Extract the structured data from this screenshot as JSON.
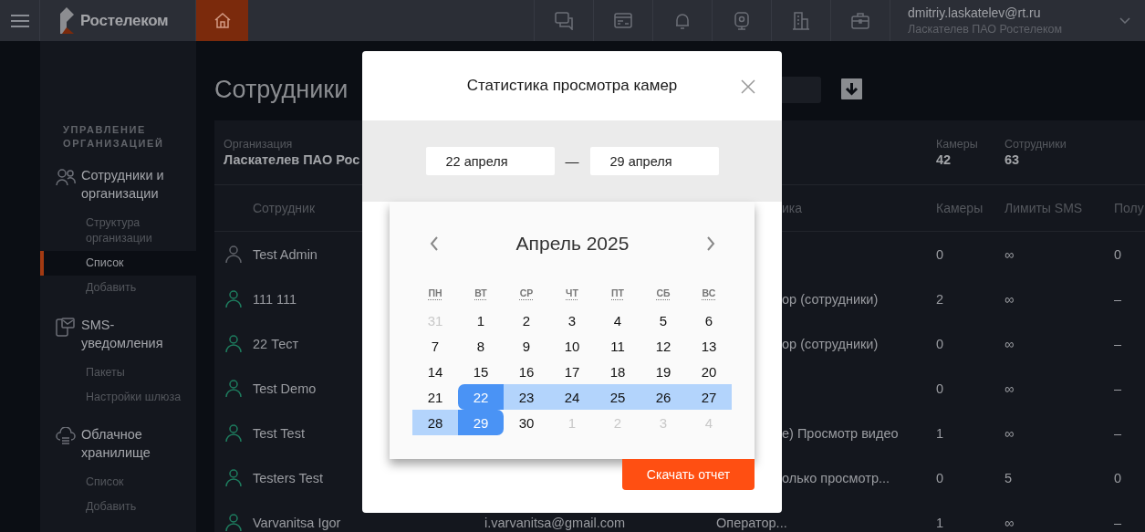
{
  "topbar": {
    "logo": "Ростелеком",
    "user_email": "dmitriy.laskatelev@rt.ru",
    "user_org": "Ласкателев ПАО Ростелеком"
  },
  "sidebar": {
    "heading": "УПРАВЛЕНИЕ ОРГАНИЗАЦИЕЙ",
    "groups": [
      {
        "label": "Сотрудники и организации",
        "kind": "people",
        "items": [
          {
            "label": "Структура организации",
            "selected": false
          },
          {
            "label": "Список",
            "selected": true
          },
          {
            "label": "Добавить",
            "selected": false
          }
        ]
      },
      {
        "label": "SMS-уведомления",
        "kind": "sms",
        "items": [
          {
            "label": "Пакеты",
            "selected": false
          },
          {
            "label": "Настройки шлюза",
            "selected": false
          }
        ]
      },
      {
        "label": "Облачное хранилище",
        "kind": "cloud",
        "items": [
          {
            "label": "Список",
            "selected": false
          },
          {
            "label": "Добавить",
            "selected": false
          }
        ]
      }
    ]
  },
  "page": {
    "title": "Сотрудники",
    "organization": {
      "label": "Организация",
      "value": "Ласкателев ПАО Рос"
    },
    "stats": [
      {
        "label": "Камеры",
        "value": "42"
      },
      {
        "label": "Сотрудники",
        "value": "63"
      }
    ]
  },
  "table": {
    "columns": [
      "Сотрудник",
      "ика",
      "Камеры",
      "Лимиты SMS",
      "Полу"
    ],
    "rows": [
      {
        "name": "Test Admin",
        "color": "#5f6269",
        "kind": "covered",
        "cameras": "0",
        "sms_limit": "∞",
        "column_8": "0"
      },
      {
        "name": "111 111",
        "color": "#1e7d5f",
        "kind": "covered",
        "role": "ор (сотрудники)",
        "cameras": "2",
        "sms_limit": "∞",
        "column_8": "–"
      },
      {
        "name": "22 Тест",
        "color": "#1e7d5f",
        "kind": "covered",
        "role": "ор (сотрудники)",
        "cameras": "0",
        "sms_limit": "∞",
        "column_8": "–"
      },
      {
        "name": "Test Demo",
        "color": "#1e7d5f",
        "kind": "covered",
        "cameras": "0",
        "sms_limit": "∞",
        "column_8": "–"
      },
      {
        "name": "Test Test",
        "color": "#1e7d5f",
        "kind": "covered",
        "role": "е) Просмотр видео",
        "cameras": "1",
        "sms_limit": "∞",
        "column_8": "–"
      },
      {
        "name": "Testers Test",
        "color": "#1e7d5f",
        "kind": "covered",
        "role": "олько просмотр...",
        "cameras": "0",
        "sms_limit": "5",
        "column_8": "0"
      },
      {
        "name": "Varvanitsa Igor",
        "color": "#1e7d5f",
        "kind": "full",
        "email": "i.varvanitsa@gmail.com",
        "role": "Оператор...",
        "cameras": "1",
        "sms_limit": "∞",
        "column_8": "–"
      }
    ]
  },
  "modal": {
    "title": "Статистика просмотра камер",
    "date_from": "22 апреля",
    "separator": "—",
    "date_to": "29 апреля",
    "calendar": {
      "month": "Апрель 2025",
      "weekdays": [
        "ПН",
        "ВТ",
        "СР",
        "ЧТ",
        "ПТ",
        "СБ",
        "ВС"
      ],
      "days": [
        {
          "label": "31",
          "outside": true,
          "selected": false,
          "in_range": false
        },
        {
          "label": "1",
          "outside": false,
          "selected": false,
          "in_range": false
        },
        {
          "label": "2",
          "outside": false,
          "selected": false,
          "in_range": false
        },
        {
          "label": "3",
          "outside": false,
          "selected": false,
          "in_range": false
        },
        {
          "label": "4",
          "outside": false,
          "selected": false,
          "in_range": false
        },
        {
          "label": "5",
          "outside": false,
          "selected": false,
          "in_range": false
        },
        {
          "label": "6",
          "outside": false,
          "selected": false,
          "in_range": false
        },
        {
          "label": "7",
          "outside": false,
          "selected": false,
          "in_range": false
        },
        {
          "label": "8",
          "outside": false,
          "selected": false,
          "in_range": false
        },
        {
          "label": "9",
          "outside": false,
          "selected": false,
          "in_range": false
        },
        {
          "label": "10",
          "outside": false,
          "selected": false,
          "in_range": false
        },
        {
          "label": "11",
          "outside": false,
          "selected": false,
          "in_range": false
        },
        {
          "label": "12",
          "outside": false,
          "selected": false,
          "in_range": false
        },
        {
          "label": "13",
          "outside": false,
          "selected": false,
          "in_range": false
        },
        {
          "label": "14",
          "outside": false,
          "selected": false,
          "in_range": false
        },
        {
          "label": "15",
          "outside": false,
          "selected": false,
          "in_range": false
        },
        {
          "label": "16",
          "outside": false,
          "selected": false,
          "in_range": false
        },
        {
          "label": "17",
          "outside": false,
          "selected": false,
          "in_range": false
        },
        {
          "label": "18",
          "outside": false,
          "selected": false,
          "in_range": false
        },
        {
          "label": "19",
          "outside": false,
          "selected": false,
          "in_range": false
        },
        {
          "label": "20",
          "outside": false,
          "selected": false,
          "in_range": false
        },
        {
          "label": "21",
          "outside": false,
          "selected": false,
          "in_range": false
        },
        {
          "label": "22",
          "outside": false,
          "selected": true,
          "in_range": false
        },
        {
          "label": "23",
          "outside": false,
          "selected": false,
          "in_range": true
        },
        {
          "label": "24",
          "outside": false,
          "selected": false,
          "in_range": true
        },
        {
          "label": "25",
          "outside": false,
          "selected": false,
          "in_range": true
        },
        {
          "label": "26",
          "outside": false,
          "selected": false,
          "in_range": true
        },
        {
          "label": "27",
          "outside": false,
          "selected": false,
          "in_range": true
        },
        {
          "label": "28",
          "outside": false,
          "selected": false,
          "in_range": true
        },
        {
          "label": "29",
          "outside": false,
          "selected": true,
          "in_range": false
        },
        {
          "label": "30",
          "outside": false,
          "selected": false,
          "in_range": false
        },
        {
          "label": "1",
          "outside": true,
          "selected": false,
          "in_range": false
        },
        {
          "label": "2",
          "outside": true,
          "selected": false,
          "in_range": false
        },
        {
          "label": "3",
          "outside": true,
          "selected": false,
          "in_range": false
        },
        {
          "label": "4",
          "outside": true,
          "selected": false,
          "in_range": false
        }
      ]
    },
    "download_button": "Скачать отчет"
  }
}
